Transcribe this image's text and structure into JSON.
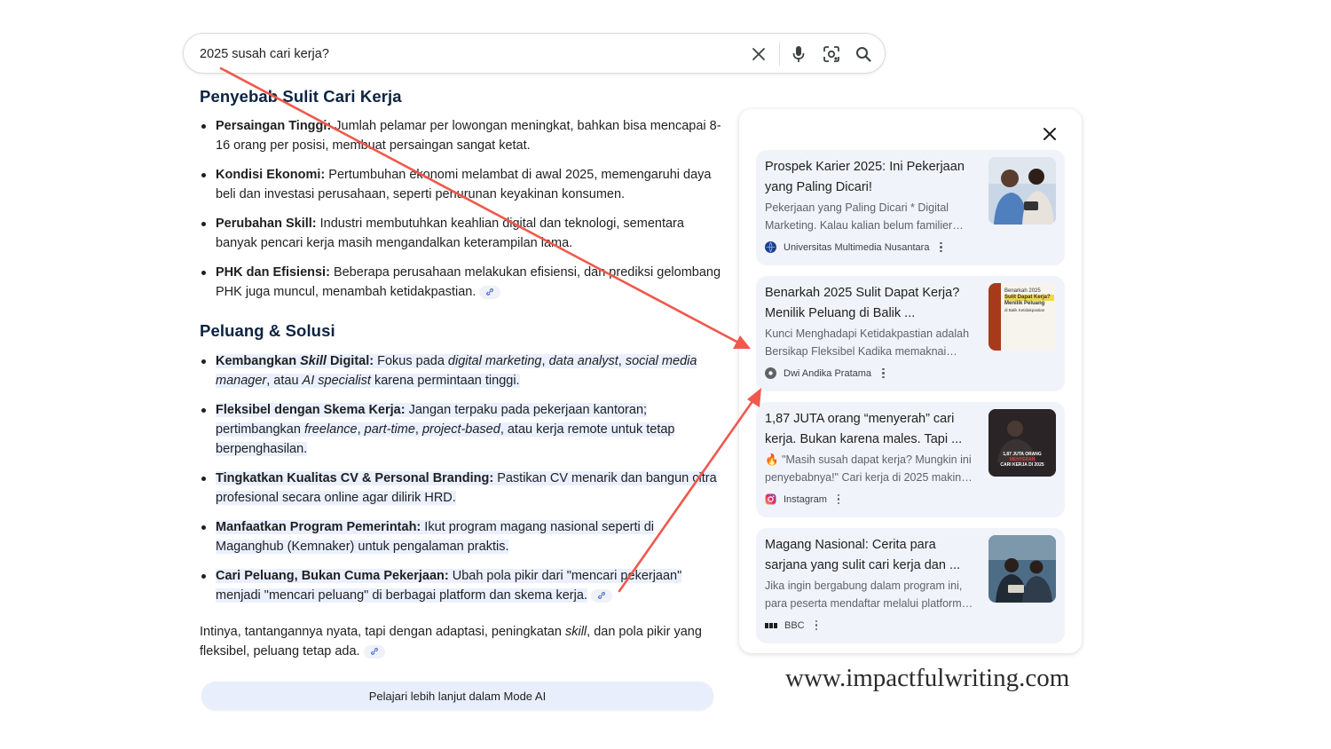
{
  "search": {
    "query": "2025 susah cari kerja?"
  },
  "icons": {
    "clear": "close-icon",
    "voice": "microphone-icon",
    "lens": "camera-lens-icon",
    "search": "search-icon"
  },
  "section1": {
    "heading": "Penyebab Sulit Cari Kerja",
    "items": [
      {
        "bold": "Persaingan Tinggi:",
        "text": " Jumlah pelamar per lowongan meningkat, bahkan bisa mencapai 8-16 orang per posisi, membuat persaingan sangat ketat."
      },
      {
        "bold": "Kondisi Ekonomi:",
        "text": " Pertumbuhan ekonomi melambat di awal 2025, memengaruhi daya beli dan investasi perusahaan, seperti penurunan keyakinan konsumen."
      },
      {
        "bold": "Perubahan Skill:",
        "text": " Industri membutuhkan keahlian digital dan teknologi, sementara banyak pencari kerja masih mengandalkan keterampilan lama."
      },
      {
        "bold": "PHK dan Efisiensi:",
        "text": " Beberapa perusahaan melakukan efisiensi, dan prediksi gelombang PHK juga muncul, menambah ketidakpastian."
      }
    ]
  },
  "section2": {
    "heading": "Peluang & Solusi",
    "items": [
      {
        "bold_a": "Kembangkan ",
        "bold_i": "Skill",
        "bold_b": " Digital:",
        "t1": " Fokus pada ",
        "i1": "digital marketing",
        "t2": ", ",
        "i2": "data analyst",
        "t3": ", ",
        "i3": "social media manager",
        "t4": ", atau ",
        "i4": "AI specialist",
        "t5": " karena permintaan tinggi."
      },
      {
        "bold": "Fleksibel dengan Skema Kerja:",
        "t1": " Jangan terpaku pada pekerjaan kantoran; pertimbangkan ",
        "i1": "freelance",
        "t2": ", ",
        "i2": "part-time",
        "t3": ", ",
        "i3": "project-based",
        "t4": ", atau kerja remote untuk tetap berpenghasilan."
      },
      {
        "bold": "Tingkatkan Kualitas CV & Personal Branding:",
        "text": " Pastikan CV menarik dan bangun citra profesional secara online agar dilirik HRD."
      },
      {
        "bold": "Manfaatkan Program Pemerintah:",
        "text": " Ikut program magang nasional seperti di Maganghub (Kemnaker) untuk pengalaman praktis."
      },
      {
        "bold": "Cari Peluang, Bukan Cuma Pekerjaan:",
        "text": " Ubah pola pikir dari \"mencari pekerjaan\" menjadi \"mencari peluang\" di berbagai platform dan skema kerja."
      }
    ]
  },
  "conclusion": {
    "t1": "Intinya, tantangannya nyata, tapi dengan adaptasi, peningkatan ",
    "i1": "skill",
    "t2": ", dan pola pikir yang fleksibel, peluang tetap ada."
  },
  "ai_mode_button": "Pelajari lebih lanjut dalam Mode AI",
  "sources": [
    {
      "title": "Prospek Karier 2025: Ini Pekerjaan yang Paling Dicari!",
      "snippet1": "Pekerjaan yang Paling Dicari * Digital",
      "snippet2": "Marketing. Kalau kalian belum familier…",
      "source": "Universitas Multimedia Nusantara",
      "icon": "globe-icon"
    },
    {
      "title": "Benarkah 2025 Sulit Dapat Kerja? Menilik Peluang di Balik ...",
      "snippet1": "Kunci Menghadapi Ketidakpastian adalah",
      "snippet2": "Bersikap Fleksibel Kadika memaknai…",
      "source": "Dwi Andika Pratama",
      "icon": "site-icon",
      "thumb_text": [
        "Benarkah 2025",
        "Sulit Dapat Kerja?",
        "Menilik Peluang",
        "di Balik Ketidakpastian"
      ]
    },
    {
      "title": "1,87 JUTA orang “menyerah” cari kerja. Bukan karena males. Tapi ...",
      "snippet1": "🔥 \"Masih susah dapat kerja? Mungkin ini",
      "snippet2": "penyebabnya!\" Cari kerja di 2025 makin…",
      "source": "Instagram",
      "icon": "instagram-icon",
      "thumb_text": [
        "1,87 JUTA ORANG",
        "MENYERAH",
        "CARI KERJA DI 2025"
      ]
    },
    {
      "title": "Magang Nasional: Cerita para sarjana yang sulit cari kerja dan ...",
      "snippet1": "Jika ingin bergabung dalam program ini,",
      "snippet2": "para peserta mendaftar melalui platform…",
      "source": "BBC",
      "icon": "bbc-icon"
    }
  ],
  "watermark": "www.impactfulwriting.com",
  "colors": {
    "heading": "#0b2341",
    "highlight": "#eaf0ff",
    "card_bg": "#f0f4fa",
    "arrow": "#f0584d"
  }
}
